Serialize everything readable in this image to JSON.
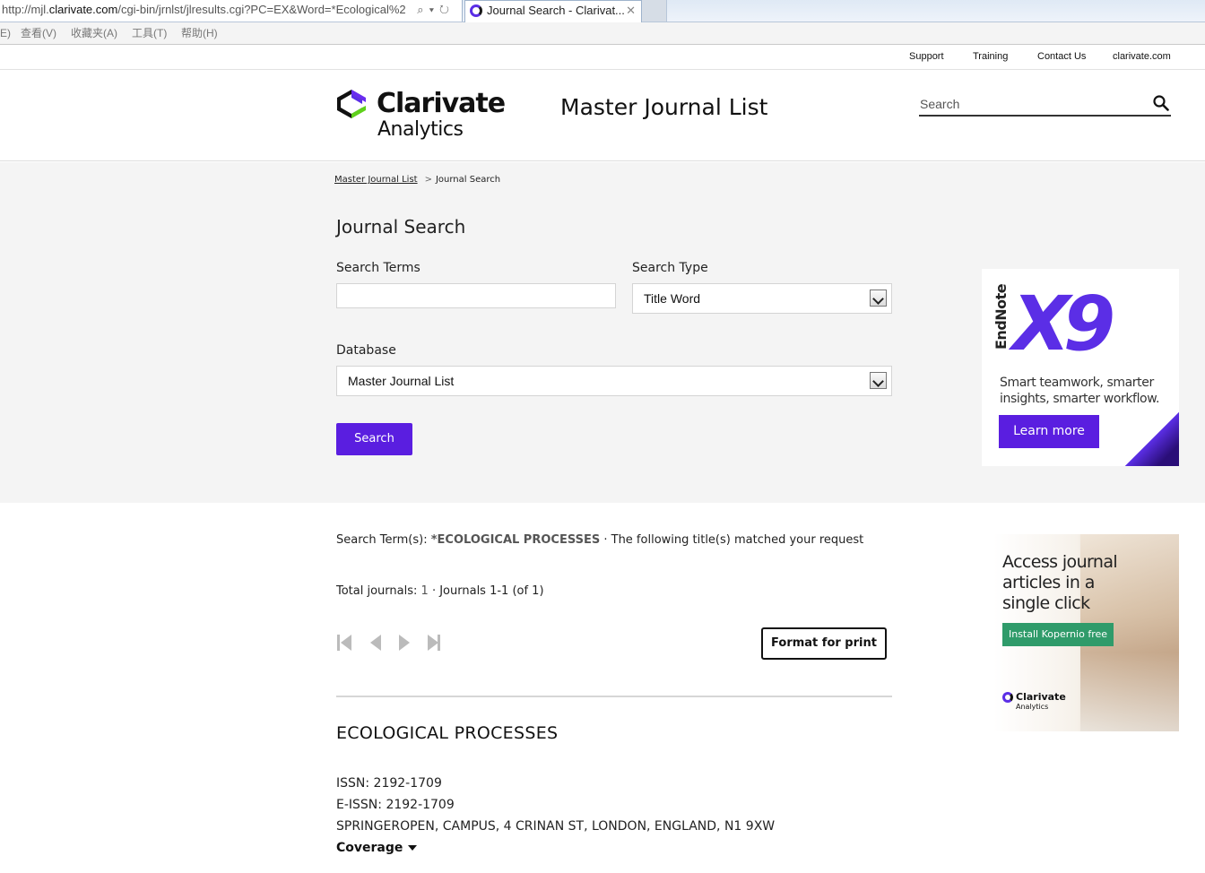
{
  "browser": {
    "url_prefix": "http://mjl.",
    "url_host": "clarivate.com",
    "url_rest": "/cgi-bin/jrnlst/jlresults.cgi?PC=EX&Word=*Ecological%2",
    "tab_title": "Journal Search - Clarivat...",
    "menu": [
      "E)",
      "查看(V)",
      "收藏夹(A)",
      "工具(T)",
      "帮助(H)"
    ]
  },
  "toplinks": [
    "Support",
    "Training",
    "Contact Us",
    "clarivate.com"
  ],
  "header": {
    "brand": "Clarivate",
    "brand_sub": "Analytics",
    "site_title": "Master Journal List",
    "search_placeholder": "Search"
  },
  "breadcrumb": {
    "home": "Master Journal List",
    "current": "Journal Search"
  },
  "search_form": {
    "heading": "Journal Search",
    "terms_label": "Search Terms",
    "terms_value": "",
    "type_label": "Search Type",
    "type_value": "Title Word",
    "database_label": "Database",
    "database_value": "Master Journal List",
    "submit_label": "Search"
  },
  "ads": {
    "endnote": {
      "product": "EndNote",
      "version": "X9",
      "tagline": "Smart teamwork, smarter insights, smarter workflow.",
      "cta": "Learn more"
    },
    "kopernio": {
      "headline": "Access journal articles in a single click",
      "cta": "Install Kopernio free",
      "brand": "Clarivate",
      "brand_sub": "Analytics"
    }
  },
  "results": {
    "term_label": "Search Term(s):",
    "term_value": "*ECOLOGICAL PROCESSES",
    "term_suffix": "· The following title(s) matched your request",
    "total_label": "Total journals:",
    "total_value": "1",
    "total_suffix": "· Journals 1-1 (of 1)",
    "print_label": "Format for print"
  },
  "journal": {
    "title": "ECOLOGICAL PROCESSES",
    "issn": "ISSN: 2192-1709",
    "eissn": "E-ISSN: 2192-1709",
    "publisher": "SPRINGEROPEN, CAMPUS, 4 CRINAN ST, LONDON, ENGLAND, N1 9XW",
    "coverage_label": "Coverage"
  },
  "colors": {
    "accent": "#5a1ee0",
    "kopernio_green": "#2f9b6a"
  }
}
